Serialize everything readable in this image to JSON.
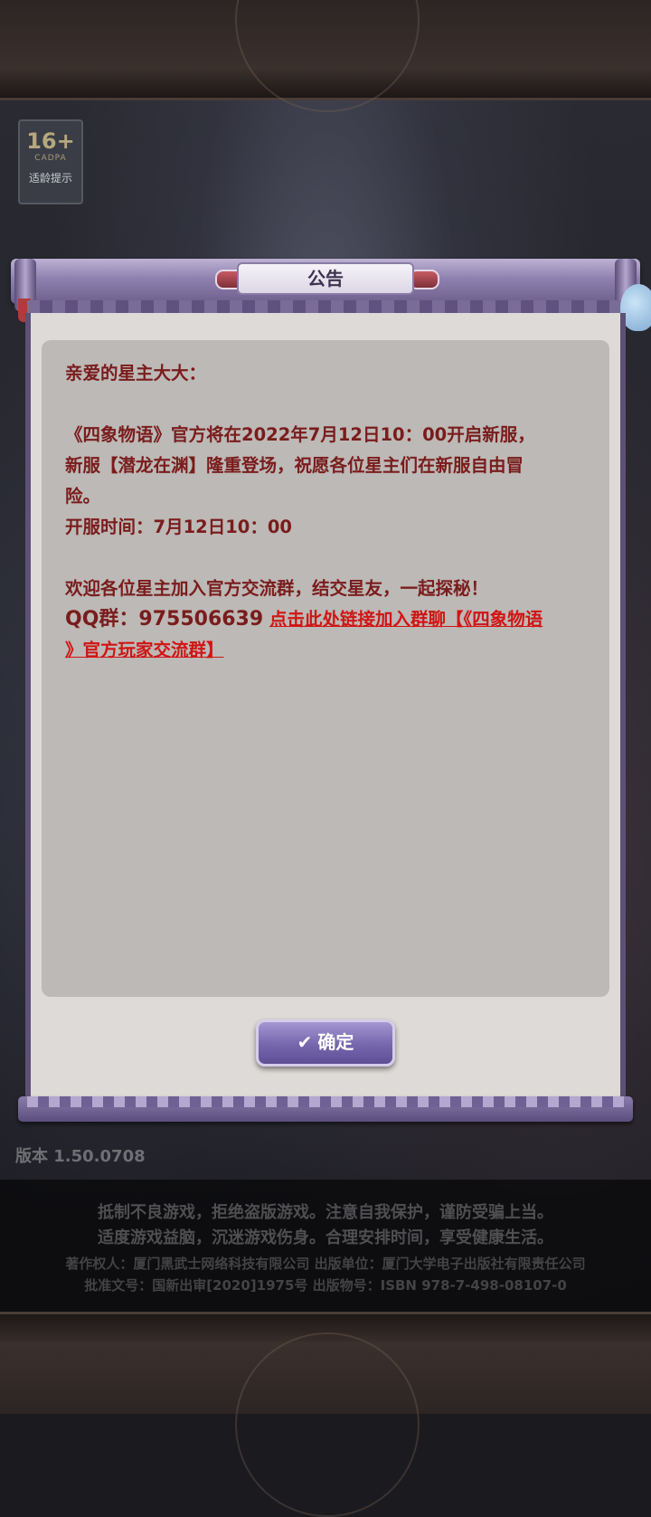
{
  "dialog": {
    "title": "公告",
    "greeting": "亲爱的星主大大：",
    "para1_line1": "《四象物语》官方将在2022年7月12日10：00开启新服，",
    "para1_line2": "新服【潜龙在渊】隆重登场，祝愿各位星主们在新服自由冒",
    "para1_line3": "险。",
    "open_time": "开服时间：7月12日10：00",
    "welcome": "欢迎各位星主加入官方交流群，结交星友，一起探秘！",
    "qq_label": "QQ群：975506639",
    "link_part1": "点击此处链接加入群聊【《四象物语",
    "link_part2": "》官方玩家交流群】",
    "confirm_label": "确定"
  },
  "age_badge": {
    "age": "16+",
    "org": "CADPA",
    "tip": "适龄提示"
  },
  "version": "版本 1.50.0708",
  "footer": {
    "line1": "抵制不良游戏，拒绝盗版游戏。注意自我保护，谨防受骗上当。",
    "line2": "适度游戏益脑，沉迷游戏伤身。合理安排时间，享受健康生活。",
    "line3": "著作权人：厦门黑武士网络科技有限公司 出版单位：厦门大学电子出版社有限责任公司",
    "line4": "批准文号：国新出审[2020]1975号 出版物号：ISBN 978-7-498-08107-0"
  },
  "colors": {
    "text_red": "#7a1c1c",
    "link_red": "#d11414",
    "button_purple": "#7566ad"
  }
}
